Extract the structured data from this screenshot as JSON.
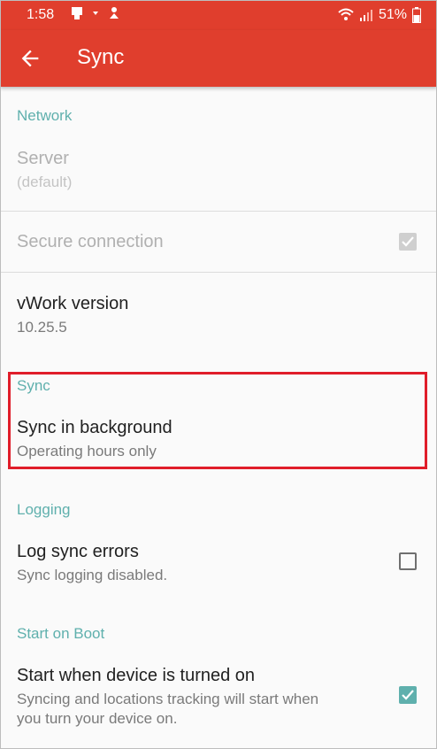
{
  "status_bar": {
    "time": "1:58",
    "battery": "51%"
  },
  "app_bar": {
    "title": "Sync",
    "back_icon": "arrow-left-icon"
  },
  "sections": {
    "network": {
      "header": "Network"
    },
    "server": {
      "title": "Server",
      "summary": "(default)"
    },
    "secure_connection": {
      "title": "Secure connection",
      "checked": true,
      "enabled": false
    },
    "version": {
      "title": "vWork version",
      "summary": "10.25.5"
    },
    "sync": {
      "header": "Sync"
    },
    "sync_background": {
      "title": "Sync in background",
      "summary": "Operating hours only"
    },
    "logging": {
      "header": "Logging"
    },
    "log_sync_errors": {
      "title": "Log sync errors",
      "summary": "Sync logging disabled.",
      "checked": false
    },
    "boot": {
      "header": "Start on Boot"
    },
    "start_on_boot": {
      "title": "Start when device is turned on",
      "summary_line1": "Syncing and locations tracking will start when",
      "summary_line2": "you turn your device on.",
      "checked": true
    }
  },
  "colors": {
    "accent": "#e03e2d",
    "category": "#5fb0ad",
    "highlight": "#e01d2a"
  }
}
